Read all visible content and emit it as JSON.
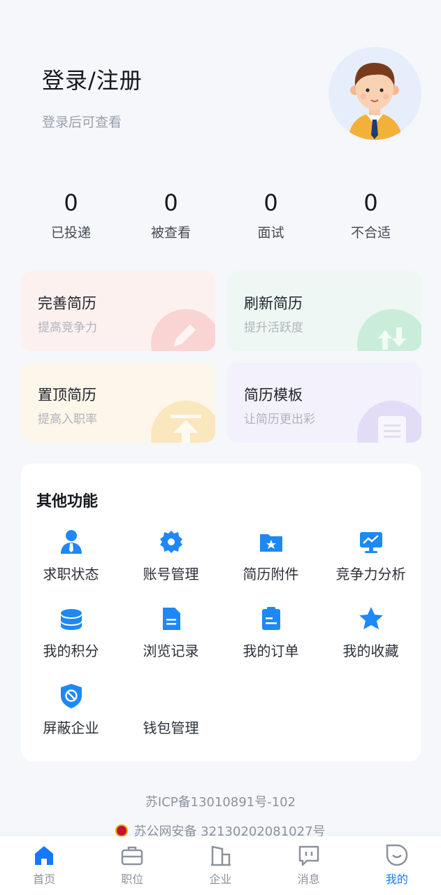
{
  "header": {
    "login_title": "登录/注册",
    "login_subtitle": "登录后可查看"
  },
  "stats": [
    {
      "value": "0",
      "label": "已投递"
    },
    {
      "value": "0",
      "label": "被查看"
    },
    {
      "value": "0",
      "label": "面试"
    },
    {
      "value": "0",
      "label": "不合适"
    }
  ],
  "cards": [
    {
      "title": "完善简历",
      "subtitle": "提高竞争力",
      "icon": "pencil-icon"
    },
    {
      "title": "刷新简历",
      "subtitle": "提升活跃度",
      "icon": "refresh-icon"
    },
    {
      "title": "置顶简历",
      "subtitle": "提高入职率",
      "icon": "arrow-up-icon"
    },
    {
      "title": "简历模板",
      "subtitle": "让简历更出彩",
      "icon": "template-icon"
    }
  ],
  "functions": {
    "title": "其他功能",
    "items": [
      {
        "label": "求职状态",
        "icon": "person-icon"
      },
      {
        "label": "账号管理",
        "icon": "gear-icon"
      },
      {
        "label": "简历附件",
        "icon": "folder-star-icon"
      },
      {
        "label": "竞争力分析",
        "icon": "monitor-chart-icon"
      },
      {
        "label": "我的积分",
        "icon": "coins-icon"
      },
      {
        "label": "浏览记录",
        "icon": "document-icon"
      },
      {
        "label": "我的订单",
        "icon": "order-icon"
      },
      {
        "label": "我的收藏",
        "icon": "star-icon"
      },
      {
        "label": "屏蔽企业",
        "icon": "block-shield-icon"
      },
      {
        "label": "钱包管理",
        "icon": ""
      }
    ]
  },
  "footer": {
    "icp": "苏ICP备13010891号-102",
    "police": "苏公网安备 32130202081027号"
  },
  "tabbar": [
    {
      "label": "首页",
      "icon": "home-icon",
      "active": false
    },
    {
      "label": "职位",
      "icon": "briefcase-icon",
      "active": false
    },
    {
      "label": "企业",
      "icon": "building-icon",
      "active": false
    },
    {
      "label": "消息",
      "icon": "message-icon",
      "active": false
    },
    {
      "label": "我的",
      "icon": "profile-icon",
      "active": true
    }
  ],
  "colors": {
    "accent": "#1677ff",
    "page_background": "#f5f7fb"
  }
}
